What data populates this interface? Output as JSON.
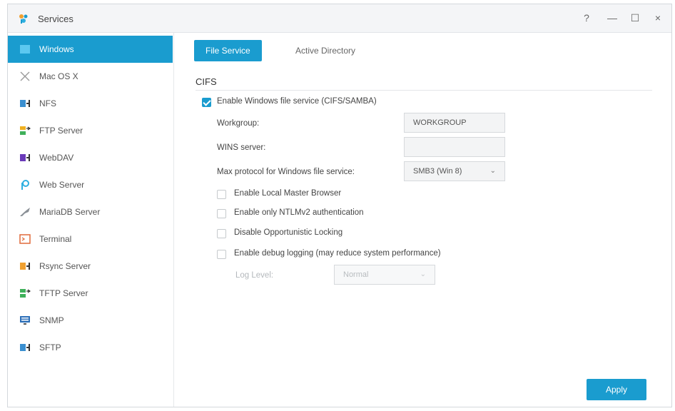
{
  "window": {
    "title": "Services",
    "controls": {
      "help": "?",
      "minimize": "—",
      "maximize": "☐",
      "close": "×"
    }
  },
  "sidebar": {
    "items": [
      {
        "label": "Windows",
        "icon": "windows-icon",
        "active": true
      },
      {
        "label": "Mac OS X",
        "icon": "mac-icon"
      },
      {
        "label": "NFS",
        "icon": "nfs-icon"
      },
      {
        "label": "FTP Server",
        "icon": "ftp-icon"
      },
      {
        "label": "WebDAV",
        "icon": "webdav-icon"
      },
      {
        "label": "Web Server",
        "icon": "web-server-icon"
      },
      {
        "label": "MariaDB Server",
        "icon": "mariadb-icon"
      },
      {
        "label": "Terminal",
        "icon": "terminal-icon"
      },
      {
        "label": "Rsync Server",
        "icon": "rsync-icon"
      },
      {
        "label": "TFTP Server",
        "icon": "tftp-icon"
      },
      {
        "label": "SNMP",
        "icon": "snmp-icon"
      },
      {
        "label": "SFTP",
        "icon": "sftp-icon"
      }
    ]
  },
  "tabs": [
    {
      "label": "File Service",
      "active": true
    },
    {
      "label": "Active Directory",
      "active": false
    }
  ],
  "cifs": {
    "section_title": "CIFS",
    "enable_label": "Enable Windows file service (CIFS/SAMBA)",
    "enable_checked": true,
    "workgroup_label": "Workgroup:",
    "workgroup_value": "WORKGROUP",
    "wins_label": "WINS server:",
    "wins_value": "",
    "max_protocol_label": "Max protocol for Windows file service:",
    "max_protocol_value": "SMB3 (Win 8)",
    "options": [
      {
        "label": "Enable Local Master Browser",
        "checked": false
      },
      {
        "label": "Enable only NTLMv2 authentication",
        "checked": false
      },
      {
        "label": "Disable Opportunistic Locking",
        "checked": false
      },
      {
        "label": "Enable debug logging (may reduce system performance)",
        "checked": false
      }
    ],
    "log_level_label": "Log Level:",
    "log_level_value": "Normal"
  },
  "apply_label": "Apply",
  "colors": {
    "accent": "#1a9ccf",
    "text": "#444444",
    "border": "#d6d9dc"
  }
}
